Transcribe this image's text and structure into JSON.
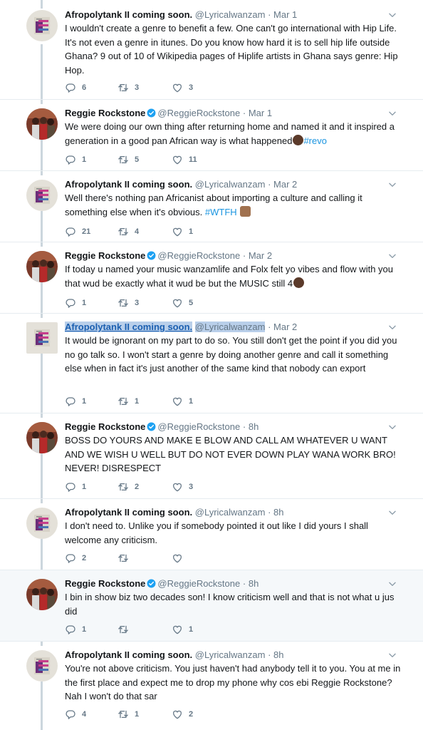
{
  "tweets": [
    {
      "author": "Afropolytank II coming soon.",
      "handle": "@Lyricalwanzam",
      "time": "Mar 1",
      "verified": false,
      "text": "I wouldn't create a genre to benefit a few. One can't go international with Hip Life. It's not even a genre in itunes. Do you know how hard it is to sell hip life outside Ghana? 9 out of 10 of Wikipedia pages of Hiplife artists in Ghana says genre: Hip Hop.",
      "replies": "6",
      "retweets": "3",
      "likes": "3"
    },
    {
      "author": "Reggie Rockstone",
      "handle": "@ReggieRockstone",
      "time": "Mar 1",
      "verified": true,
      "text": "We were doing our own thing after returning home and named it and it inspired a generation in a good pan African way is what happened",
      "hashtag": "#revo",
      "replies": "1",
      "retweets": "5",
      "likes": "11"
    },
    {
      "author": "Afropolytank II coming soon.",
      "handle": "@Lyricalwanzam",
      "time": "Mar 2",
      "verified": false,
      "text": "Well there's nothing pan Africanist about importing a culture and calling it something else when it's obvious.",
      "hashtag": "#WTFH",
      "replies": "21",
      "retweets": "4",
      "likes": "1"
    },
    {
      "author": "Reggie Rockstone",
      "handle": "@ReggieRockstone",
      "time": "Mar 2",
      "verified": true,
      "text": "If today u named your music wanzamlife and Folx felt yo vibes and flow with you that wud be exactly what it wud be but the MUSIC still 4",
      "replies": "1",
      "retweets": "3",
      "likes": "5"
    },
    {
      "author": "Afropolytank II coming soon.",
      "handle": "@Lyricalwanzam",
      "time": "Mar 2",
      "verified": false,
      "text": "It would be ignorant on my part to do so. You still don't get the point if you did you no go talk so. I won't start a genre by doing another genre and call it something else when in fact it's just another of the same kind that nobody can export",
      "replies": "1",
      "retweets": "1",
      "likes": "1"
    },
    {
      "author": "Reggie Rockstone",
      "handle": "@ReggieRockstone",
      "time": "8h",
      "verified": true,
      "text": "BOSS DO YOURS AND MAKE E BLOW AND CALL AM WHATEVER U WANT AND WE WISH U WELL BUT DO NOT EVER DOWN PLAY WANA WORK BRO! NEVER! DISRESPECT",
      "replies": "1",
      "retweets": "2",
      "likes": "3"
    },
    {
      "author": "Afropolytank II coming soon.",
      "handle": "@Lyricalwanzam",
      "time": "8h",
      "verified": false,
      "text": "I don't need to. Unlike you if somebody pointed it out like I did yours I shall welcome any criticism.",
      "replies": "2",
      "retweets": "",
      "likes": ""
    },
    {
      "author": "Reggie Rockstone",
      "handle": "@ReggieRockstone",
      "time": "8h",
      "verified": true,
      "text": "I bin in show biz two decades son! I know criticism well and that is not what u jus did",
      "replies": "1",
      "retweets": "",
      "likes": "1"
    },
    {
      "author": "Afropolytank II coming soon.",
      "handle": "@Lyricalwanzam",
      "time": "8h",
      "verified": false,
      "text": "You're not above criticism. You just haven't had anybody tell it to you. You at me in the first place and expect me to drop my phone why cos ebi Reggie Rockstone? Nah I won't do that sar",
      "replies": "4",
      "retweets": "1",
      "likes": "2"
    }
  ],
  "separator": "·",
  "colors": {
    "accent": "#1b95e0",
    "muted": "#657786",
    "highlight": "#f5f8fa"
  }
}
